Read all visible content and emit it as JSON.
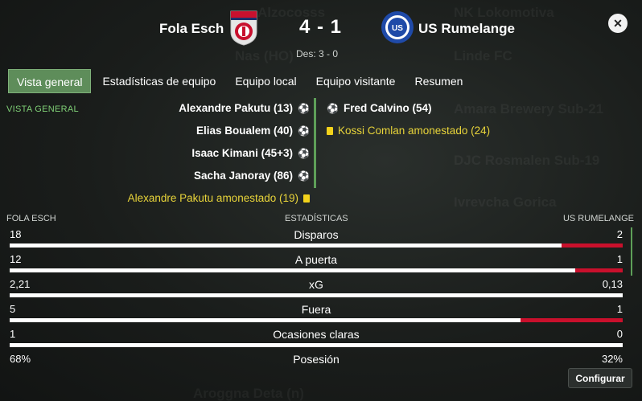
{
  "header": {
    "home_team": "Fola Esch",
    "away_team": "US Rumelange",
    "score": "4 - 1",
    "des": "Des: 3 - 0",
    "close_icon": "close-icon"
  },
  "tabs": [
    {
      "label": "Vista general",
      "active": true
    },
    {
      "label": "Estadísticas de equipo",
      "active": false
    },
    {
      "label": "Equipo local",
      "active": false
    },
    {
      "label": "Equipo visitante",
      "active": false
    },
    {
      "label": "Resumen",
      "active": false
    }
  ],
  "section_label": "VISTA GENERAL",
  "events": {
    "home": [
      {
        "text": "Alexandre Pakutu (13)",
        "type": "goal"
      },
      {
        "text": "Elias Boualem (40)",
        "type": "goal"
      },
      {
        "text": "Isaac Kimani (45+3)",
        "type": "goal"
      },
      {
        "text": "Sacha Janoray (86)",
        "type": "goal"
      },
      {
        "text": "Alexandre Pakutu amonestado (19)",
        "type": "yellow-card"
      }
    ],
    "away": [
      {
        "text": "Fred Calvino (54)",
        "type": "goal"
      },
      {
        "text": "Kossi Comlan amonestado (24)",
        "type": "yellow-card"
      }
    ]
  },
  "stats": {
    "home_label": "FOLA ESCH",
    "title": "ESTADÍSTICAS",
    "away_label": "US RUMELANGE",
    "rows": [
      {
        "name": "Disparos",
        "home": "18",
        "away": "2",
        "home_share": 0.9
      },
      {
        "name": "A puerta",
        "home": "12",
        "away": "1",
        "home_share": 0.923
      },
      {
        "name": "xG",
        "home": "2,21",
        "away": "0,13",
        "home_share": 1.0
      },
      {
        "name": "Fuera",
        "home": "5",
        "away": "1",
        "home_share": 0.833
      },
      {
        "name": "Ocasiones claras",
        "home": "1",
        "away": "0",
        "home_share": 1.0
      },
      {
        "name": "Posesión",
        "home": "68%",
        "away": "32%"
      }
    ]
  },
  "buttons": {
    "configurar": "Configurar"
  },
  "colors": {
    "accent_green": "#5e8d5a",
    "away_bar": "#c9102c",
    "home_bar": "#ffffff",
    "yellow_card": "#f2d21b"
  }
}
